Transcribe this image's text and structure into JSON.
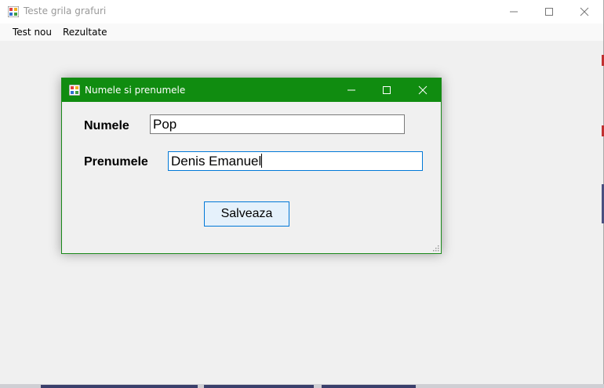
{
  "main_window": {
    "title": "Teste grila grafuri",
    "menu": [
      "Test nou",
      "Rezultate"
    ]
  },
  "dialog": {
    "title": "Numele si prenumele",
    "fields": {
      "nume_label": "Numele",
      "nume_value": "Pop",
      "prenume_label": "Prenumele",
      "prenume_value": "Denis Emanuel"
    },
    "save_label": "Salveaza"
  },
  "colors": {
    "dialog_titlebar": "#108c10",
    "button_bg": "#e5f1fb",
    "focus_border": "#0078d7"
  },
  "icons": [
    "app-icon",
    "minimize-icon",
    "maximize-icon",
    "close-icon",
    "resize-grip-icon"
  ]
}
